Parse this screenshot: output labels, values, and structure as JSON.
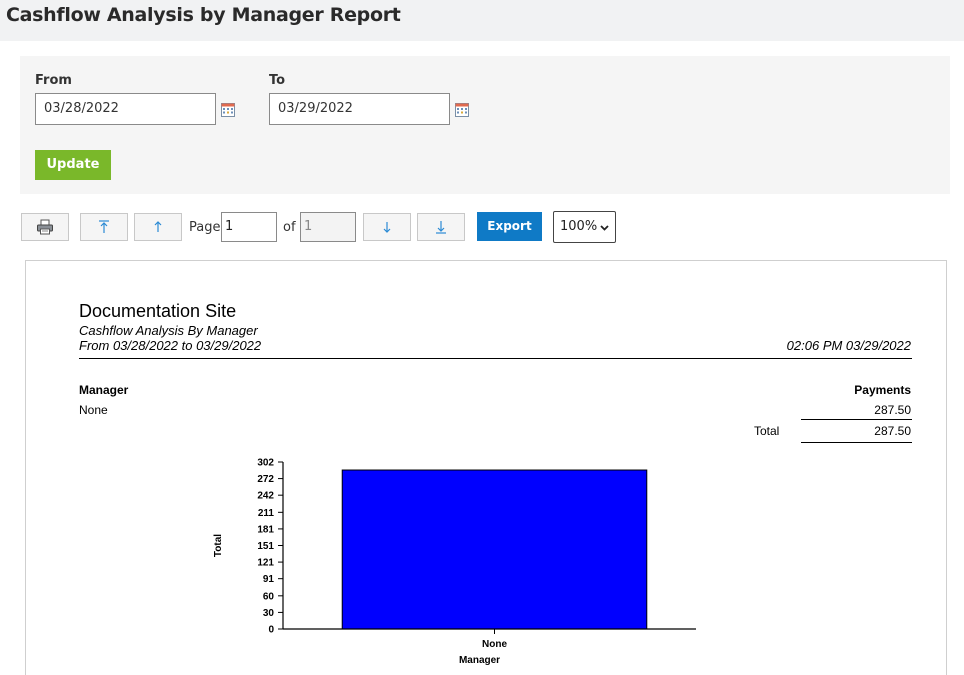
{
  "header": {
    "title": "Cashflow Analysis by Manager Report"
  },
  "filters": {
    "from_label": "From",
    "from_value": "03/28/2022",
    "to_label": "To",
    "to_value": "03/29/2022",
    "update_label": "Update"
  },
  "toolbar": {
    "page_label": "Page",
    "page_value": "1",
    "of_label": "of",
    "total_pages": "1",
    "export_label": "Export",
    "zoom_value": "100%"
  },
  "report": {
    "site_name": "Documentation Site",
    "report_name": "Cashflow Analysis By Manager",
    "date_range": "From 03/28/2022 to 03/29/2022",
    "generated_at": "02:06 PM 03/29/2022",
    "col_manager": "Manager",
    "col_payments": "Payments",
    "rows": [
      {
        "manager": "None",
        "payments": "287.50"
      }
    ],
    "total_label": "Total",
    "total_value": "287.50"
  },
  "chart_data": {
    "type": "bar",
    "categories": [
      "None"
    ],
    "values": [
      287.5
    ],
    "title": "",
    "xlabel": "Manager",
    "ylabel": "Total",
    "yticks": [
      "0",
      "30",
      "60",
      "91",
      "121",
      "151",
      "181",
      "211",
      "242",
      "272",
      "302"
    ],
    "ylim": [
      0,
      302
    ],
    "bar_color": "#0000ff"
  },
  "colors": {
    "update_button": "#7ab82a",
    "export_button": "#0f7ac6",
    "bar": "#0000ff"
  }
}
